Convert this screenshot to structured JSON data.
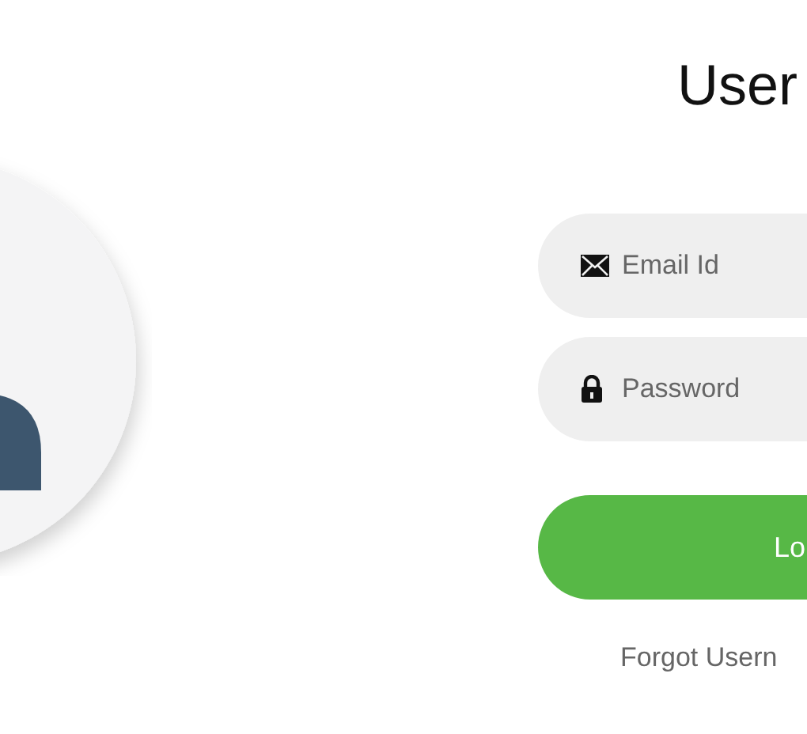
{
  "title": "User",
  "fields": [
    {
      "kind": "email",
      "placeholder": "Email Id"
    },
    {
      "kind": "password",
      "placeholder": "Password"
    }
  ],
  "login_button": "Lo",
  "forgot_link": "Forgot Usern"
}
